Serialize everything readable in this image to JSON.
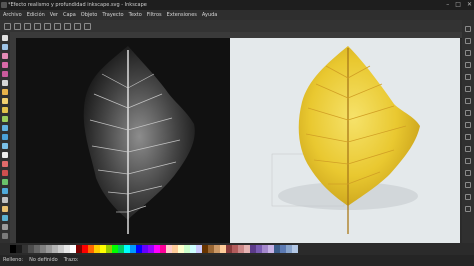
{
  "window": {
    "title": "*Efecto realismo y profundidad inkscape.svg - Inkscape"
  },
  "menu": [
    "Archivo",
    "Edición",
    "Ver",
    "Capa",
    "Objeto",
    "Trayecto",
    "Texto",
    "Filtros",
    "Extensiones",
    "Ayuda"
  ],
  "status": {
    "fill_label": "Relleno:",
    "stroke_label": "Trazo:",
    "none_label": "No definido"
  },
  "palette": [
    "#000000",
    "#1a1a1a",
    "#333333",
    "#4d4d4d",
    "#666666",
    "#808080",
    "#999999",
    "#b3b3b3",
    "#cccccc",
    "#e6e6e6",
    "#ffffff",
    "#800000",
    "#ff0000",
    "#ff6600",
    "#ffcc00",
    "#ffff00",
    "#99cc00",
    "#00ff00",
    "#00cc66",
    "#00ffff",
    "#0099ff",
    "#0000ff",
    "#6600ff",
    "#9900ff",
    "#ff00ff",
    "#ff0099",
    "#ffcccc",
    "#ffcc99",
    "#ffffcc",
    "#ccffcc",
    "#ccffff",
    "#ccccff",
    "#663300",
    "#996633",
    "#cc9966",
    "#ffcc99",
    "#8a3b3b",
    "#b35c5c",
    "#cc8888",
    "#e6b3b3",
    "#5c3b8a",
    "#7a5cb3",
    "#a488cc",
    "#c8b3e6",
    "#3b5c8a",
    "#5c7ab3",
    "#88a4cc",
    "#b3c8e6"
  ]
}
